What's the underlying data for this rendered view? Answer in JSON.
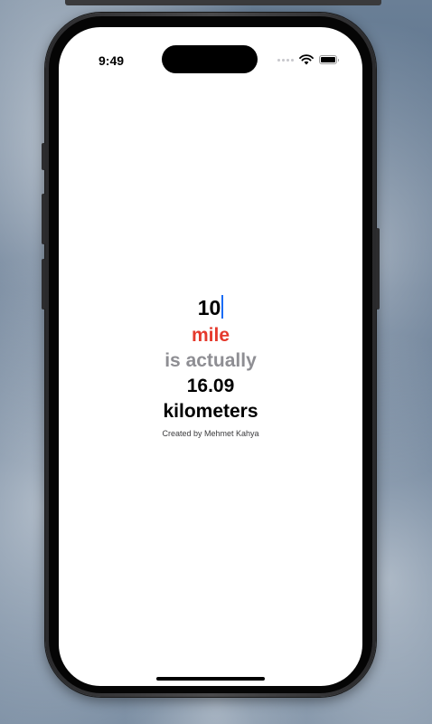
{
  "status_bar": {
    "time": "9:49",
    "icons": [
      "cellular-signal-icon",
      "wifi-icon",
      "battery-icon"
    ]
  },
  "converter": {
    "input_value": "10",
    "from_unit": "mile",
    "connector_text": "is actually",
    "result_value": "16.09",
    "to_unit": "kilometers",
    "credit": "Created by Mehmet Kahya"
  },
  "colors": {
    "from_unit": "#e5392c",
    "connector": "#8e8e93",
    "caret": "#1a6cf5",
    "screen_background": "#ffffff"
  }
}
